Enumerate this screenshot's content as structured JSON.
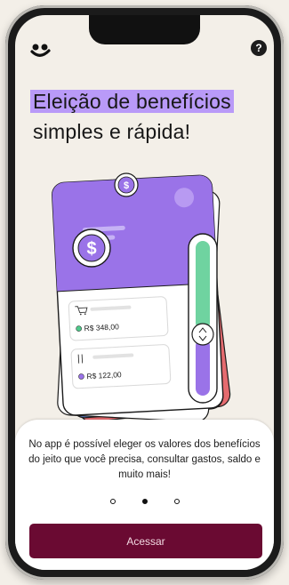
{
  "header": {
    "logo_icon": "smile-logo-icon",
    "help_label": "?"
  },
  "headline": {
    "highlighted": "Eleição de benefícios",
    "rest": "simples e rápida!"
  },
  "illustration": {
    "amounts": [
      {
        "icon": "cart-icon",
        "value": "R$ 348,00",
        "dot_color": "#4fc98b"
      },
      {
        "icon": "cutlery-icon",
        "value": "R$ 122,00",
        "dot_color": "#9a73e8"
      }
    ],
    "coin_icon": "dollar-coin-icon",
    "slider_icon": "slider-handle-icon"
  },
  "sheet": {
    "description": "No app é possível eleger os valores dos benefícios do jeito que você precisa, consultar gastos, saldo e muito mais!",
    "pagination": {
      "total": 3,
      "active": 1
    },
    "button_label": "Acessar"
  },
  "colors": {
    "background": "#f3efe8",
    "highlight": "#b99af8",
    "button": "#6a0a32",
    "card_purple": "#9a73e8",
    "card_red": "#e56b6f",
    "card_blue": "#6c8fe6",
    "slider_green": "#6fd3a0"
  }
}
